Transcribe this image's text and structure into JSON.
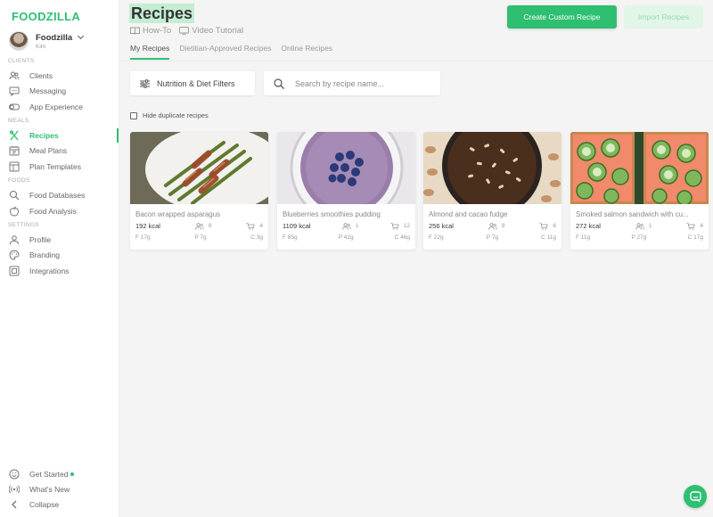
{
  "brand": {
    "logo": "FOODZILLA",
    "accent": "#2fbf71"
  },
  "user": {
    "name": "Foodzilla",
    "sub": "Kim"
  },
  "sidebar": {
    "sections": [
      {
        "label": "CLIENTS"
      },
      {
        "label": "MEALS"
      },
      {
        "label": "FOODS"
      },
      {
        "label": "SETTINGS"
      }
    ],
    "items": [
      {
        "label": "Clients",
        "icon": "users-icon"
      },
      {
        "label": "Messaging",
        "icon": "chat-icon"
      },
      {
        "label": "App Experience",
        "icon": "toggle-icon"
      },
      {
        "label": "Recipes",
        "icon": "utensils-icon"
      },
      {
        "label": "Meal Plans",
        "icon": "calendar-icon"
      },
      {
        "label": "Plan Templates",
        "icon": "template-icon"
      },
      {
        "label": "Food Databases",
        "icon": "search-icon"
      },
      {
        "label": "Food Analysis",
        "icon": "apple-icon"
      },
      {
        "label": "Profile",
        "icon": "user-icon"
      },
      {
        "label": "Branding",
        "icon": "palette-icon"
      },
      {
        "label": "Integrations",
        "icon": "integrations-icon"
      }
    ],
    "bottom": [
      {
        "label": "Get Started",
        "icon": "smile-icon"
      },
      {
        "label": "What's New",
        "icon": "broadcast-icon"
      },
      {
        "label": "Collapse",
        "icon": "chevron-left-icon"
      }
    ]
  },
  "header": {
    "title": "Recipes",
    "howto": "How-To",
    "video": "Video Tutorial",
    "create_label": "Create Custom Recipe",
    "import_label": "Import Recipes"
  },
  "tabs": [
    {
      "label": "My Recipes"
    },
    {
      "label": "Dietitian-Approved Recipes"
    },
    {
      "label": "Online Recipes"
    }
  ],
  "filters": {
    "nutrition_label": "Nutrition & Diet Filters",
    "search_placeholder": "Search by recipe name...",
    "hide_duplicates": "Hide duplicate recipes"
  },
  "recipes": [
    {
      "title": "Bacon wrapped asparagus",
      "kcal": "192 kcal",
      "servings": "8",
      "ingredients": "4",
      "f": "F 17g",
      "p": "P 7g",
      "c": "C 3g"
    },
    {
      "title": "Blueberries smoothies pudding",
      "kcal": "1109 kcal",
      "servings": "1",
      "ingredients": "12",
      "f": "F 85g",
      "p": "P 42g",
      "c": "C 46g"
    },
    {
      "title": "Almond and cacao fudge",
      "kcal": "256 kcal",
      "servings": "8",
      "ingredients": "6",
      "f": "F 22g",
      "p": "P 7g",
      "c": "C 11g"
    },
    {
      "title": "Smoked salmon sandwich with cu...",
      "kcal": "272 kcal",
      "servings": "1",
      "ingredients": "4",
      "f": "F 11g",
      "p": "P 27g",
      "c": "C 17g"
    }
  ]
}
